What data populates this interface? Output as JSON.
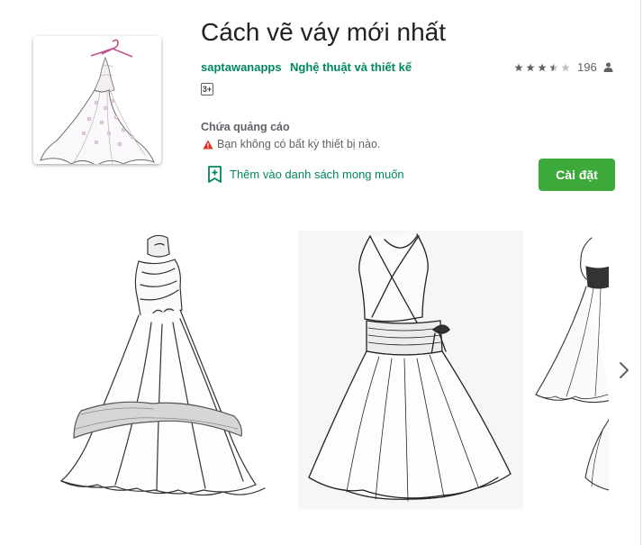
{
  "app": {
    "title": "Cách vẽ váy mới nhất",
    "developer": "saptawanapps",
    "category": "Nghệ thuật và thiết kế",
    "rating_stars": 3.5,
    "rating_count": "196",
    "content_rating": "3+",
    "ads_label": "Chứa quảng cáo",
    "device_warning": "Bạn không có bất kỳ thiết bị nào.",
    "wishlist_label": "Thêm vào danh sách mong muốn",
    "install_label": "Cài đặt"
  },
  "icons": {
    "rating": [
      "star-icon",
      "star-icon",
      "star-icon",
      "star-half-icon",
      "star-empty-icon"
    ],
    "person": "person-icon",
    "warning": "warning-icon",
    "wishlist": "bookmark-add-icon",
    "next": "chevron-right-icon"
  },
  "colors": {
    "accent": "#01875f",
    "install_button": "#3ea93b",
    "warning": "#d93025",
    "star_filled": "#5f6368",
    "star_empty": "#c0c0c0"
  },
  "screenshots": [
    {
      "name": "gown-drawing"
    },
    {
      "name": "wrap-dress-drawing"
    },
    {
      "name": "strapless-dress-drawing"
    }
  ]
}
